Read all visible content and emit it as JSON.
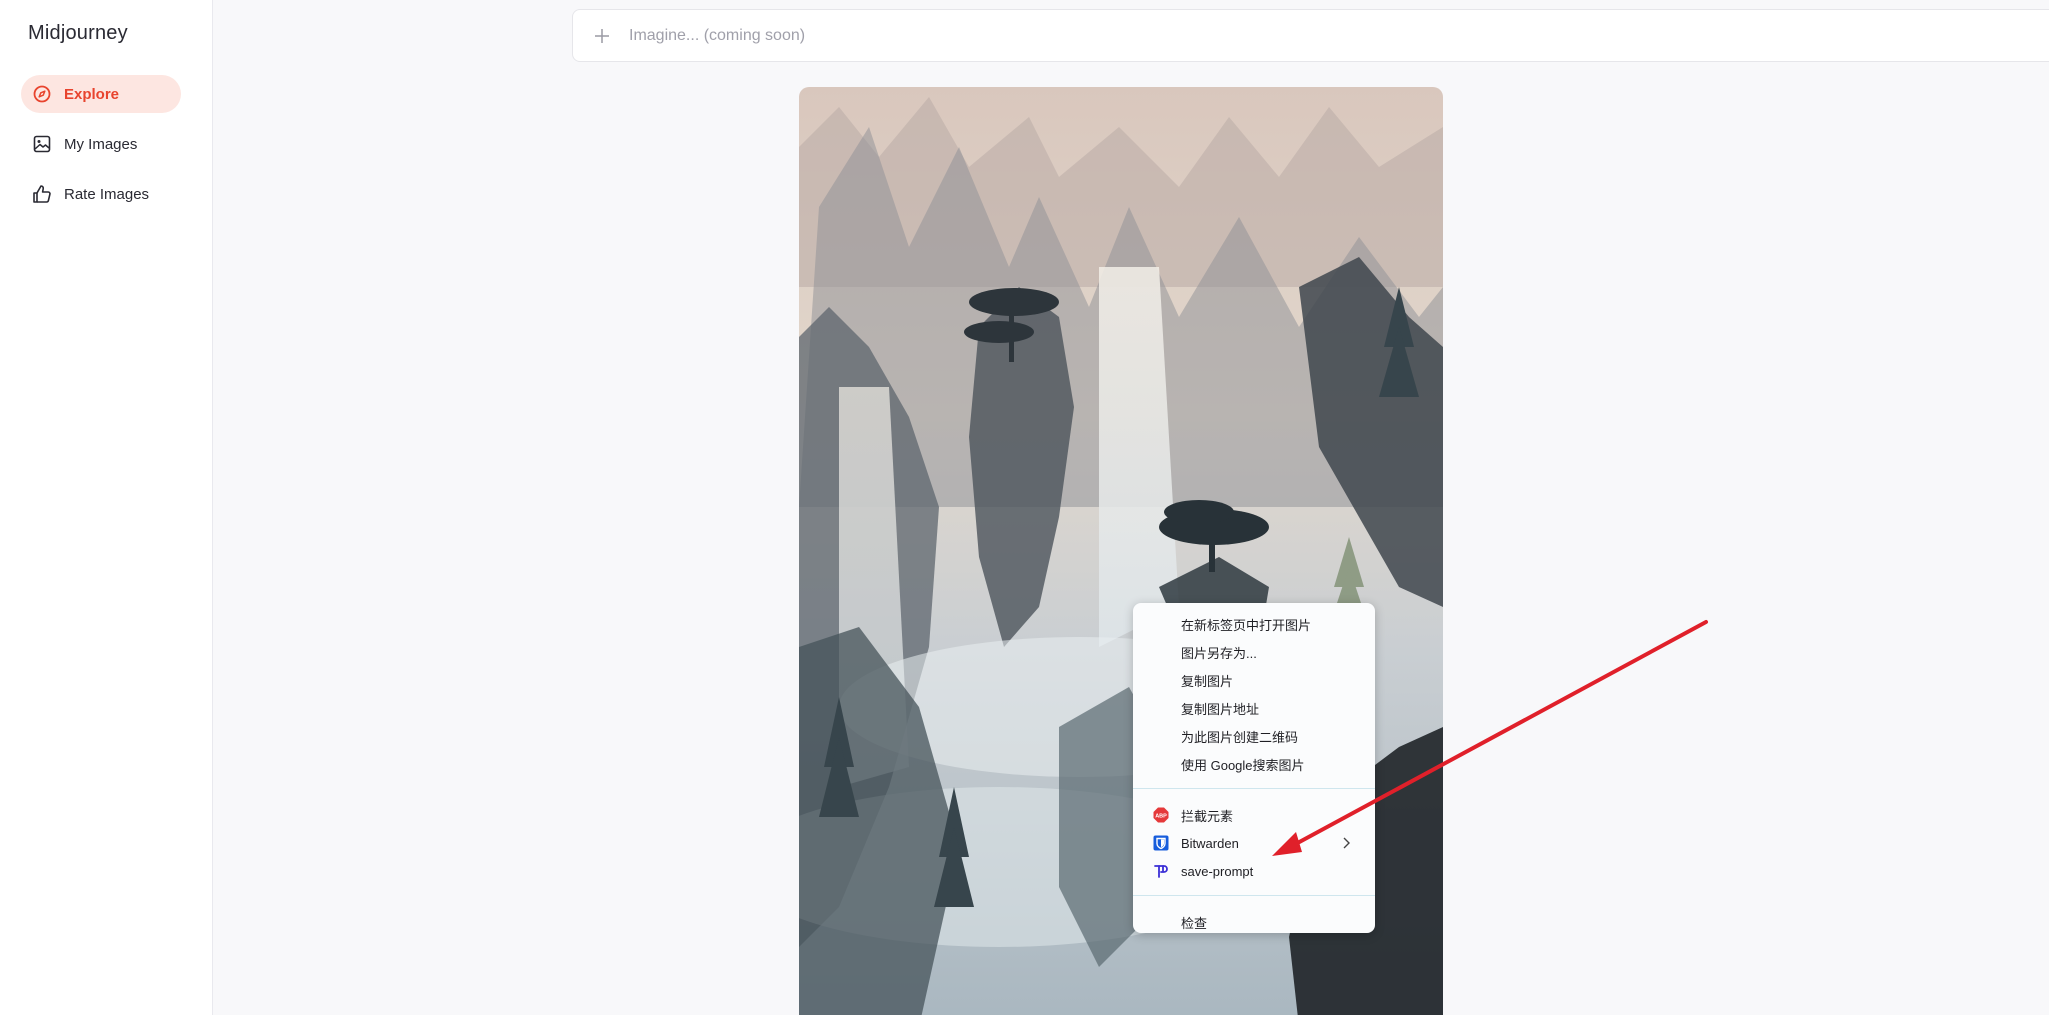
{
  "app": {
    "brand": "Midjourney"
  },
  "sidebar": {
    "items": [
      {
        "label": "Explore",
        "icon": "compass-icon",
        "active": true
      },
      {
        "label": "My Images",
        "icon": "image-icon",
        "active": false
      },
      {
        "label": "Rate Images",
        "icon": "thumbs-up-icon",
        "active": false
      }
    ]
  },
  "prompt": {
    "placeholder": "Imagine... (coming soon)",
    "icon": "plus-icon"
  },
  "main_image": {
    "subject": "ink-wash-mountain-landscape"
  },
  "context_menu": {
    "group1": [
      {
        "label": "在新标签页中打开图片"
      },
      {
        "label": "图片另存为..."
      },
      {
        "label": "复制图片"
      },
      {
        "label": "复制图片地址"
      },
      {
        "label": "为此图片创建二维码"
      },
      {
        "label": "使用 Google搜索图片"
      }
    ],
    "group2": [
      {
        "label": "拦截元素",
        "icon": "adblock-icon"
      },
      {
        "label": "Bitwarden",
        "icon": "bitwarden-icon",
        "has_submenu": true
      },
      {
        "label": "save-prompt",
        "icon": "save-prompt-icon"
      }
    ],
    "group3": [
      {
        "label": "检查"
      }
    ]
  },
  "colors": {
    "accent": "#e8442e",
    "accent_bg": "#fde6e1",
    "annotation_arrow": "#e0202a"
  }
}
